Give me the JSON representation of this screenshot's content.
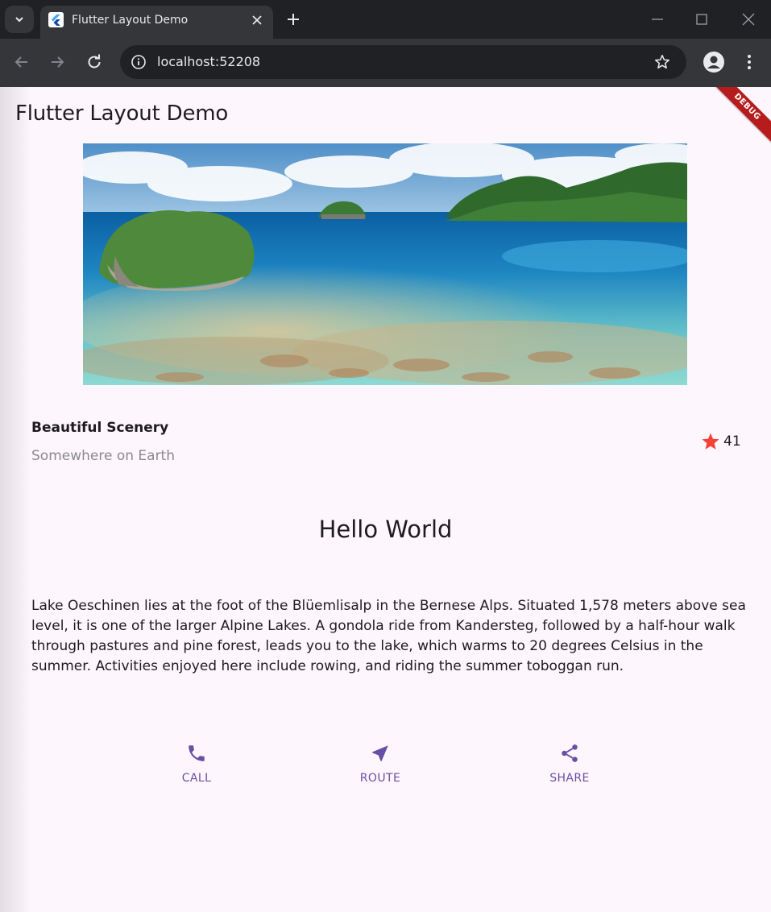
{
  "browser": {
    "tab_title": "Flutter Layout Demo",
    "url": "localhost:52208"
  },
  "app": {
    "title": "Flutter Layout Demo",
    "debug_banner": "DEBUG"
  },
  "place": {
    "name": "Beautiful Scenery",
    "location": "Somewhere on Earth",
    "rating_count": "41",
    "star_color": "#f44336"
  },
  "heading": "Hello World",
  "description": "Lake Oeschinen lies at the foot of the Blüemlisalp in the Bernese Alps. Situated 1,578 meters above sea level, it is one of the larger Alpine Lakes. A gondola ride from Kandersteg, followed by a half-hour walk through pastures and pine forest, leads you to the lake, which warms to 20 degrees Celsius in the summer. Activities enjoyed here include rowing, and riding the summer toboggan run.",
  "actions": [
    {
      "label": "CALL",
      "icon": "phone-icon"
    },
    {
      "label": "ROUTE",
      "icon": "navigation-icon"
    },
    {
      "label": "SHARE",
      "icon": "share-icon"
    }
  ],
  "accent_color": "#6750a4"
}
